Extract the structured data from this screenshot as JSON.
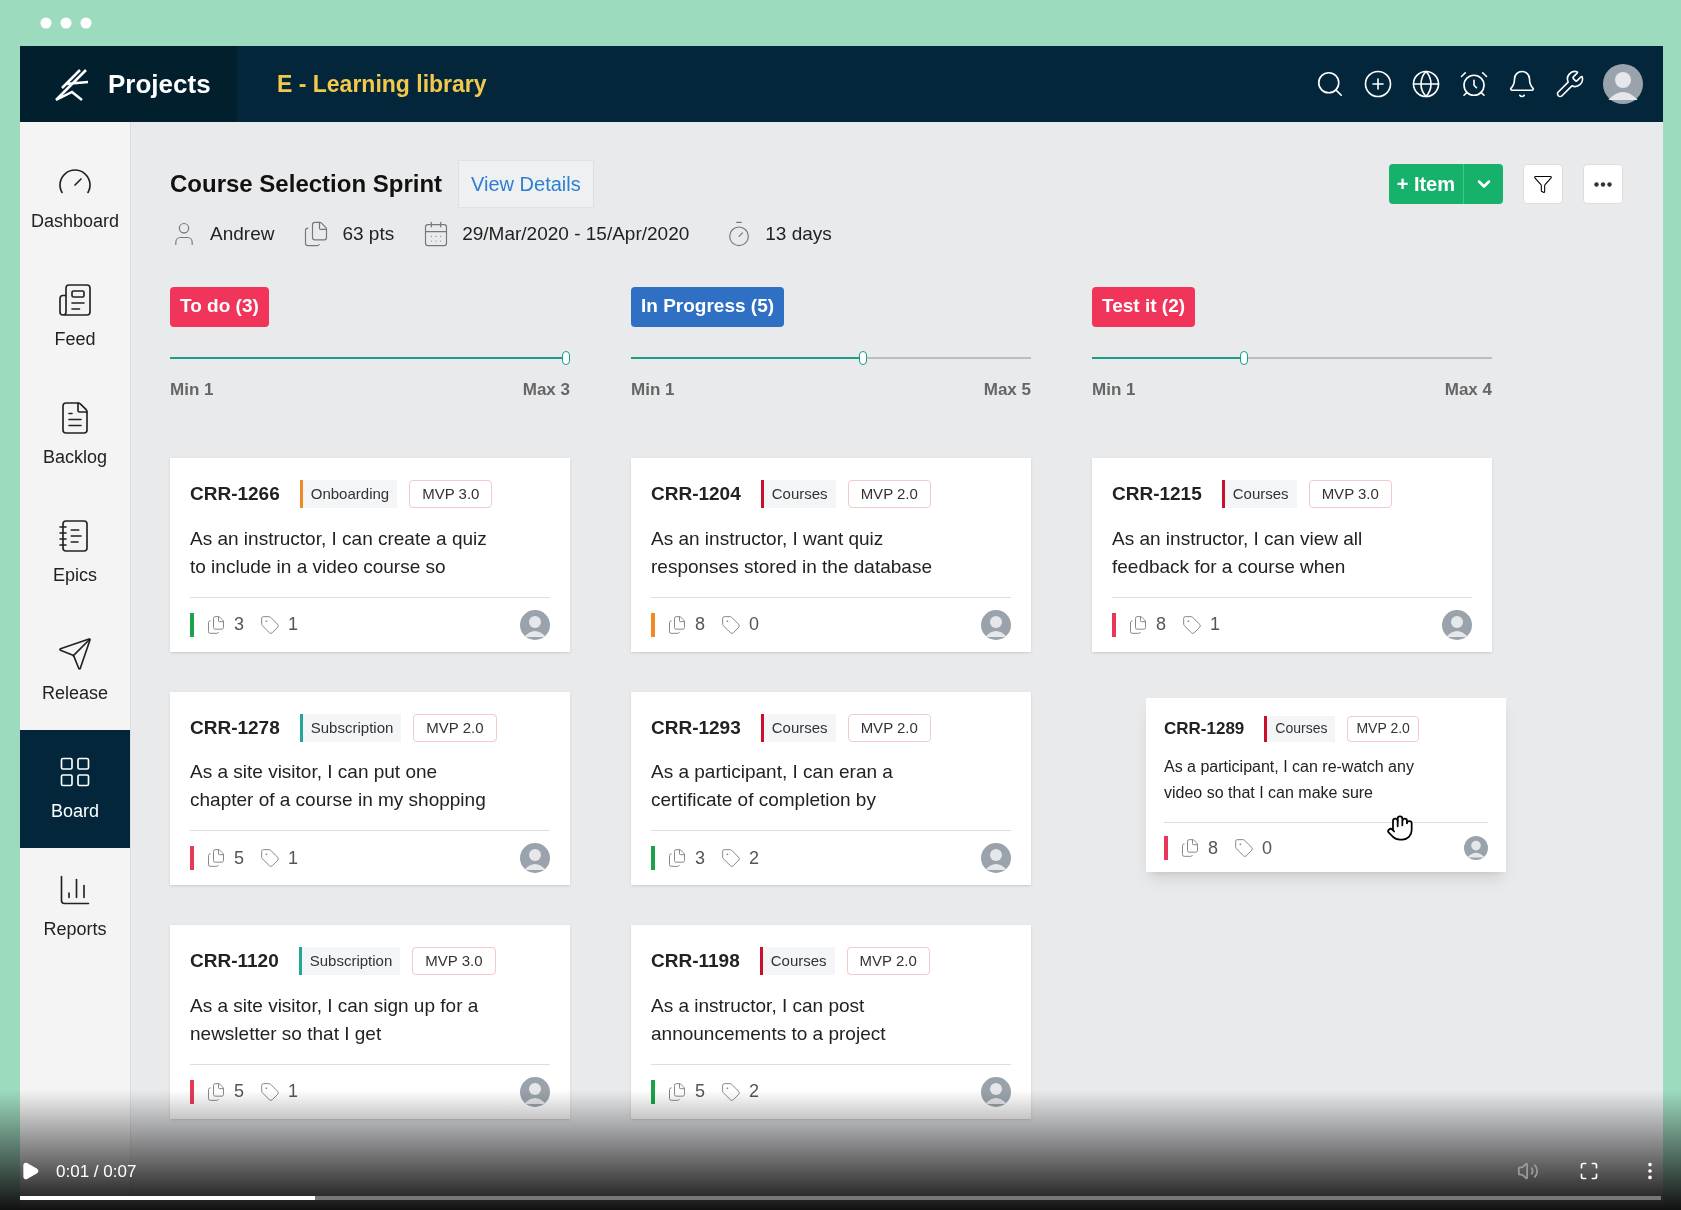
{
  "header": {
    "app": "Projects",
    "project": "E - Learning library"
  },
  "sidebar": {
    "items": [
      {
        "label": "Dashboard",
        "selected": false
      },
      {
        "label": "Feed",
        "selected": false
      },
      {
        "label": "Backlog",
        "selected": false
      },
      {
        "label": "Epics",
        "selected": false
      },
      {
        "label": "Release",
        "selected": false
      },
      {
        "label": "Board",
        "selected": true
      },
      {
        "label": "Reports",
        "selected": false
      }
    ]
  },
  "sprint": {
    "title": "Course Selection Sprint",
    "view_details": "View Details",
    "owner": "Andrew",
    "points": "63 pts",
    "dates": "29/Mar/2020 - 15/Apr/2020",
    "duration": "13 days"
  },
  "toolbar": {
    "add_item": "+ Item"
  },
  "columns": [
    {
      "title": "To do (3)",
      "color": "#f0345a",
      "min": "Min 1",
      "max": "Max 3",
      "level": 1,
      "cards": [
        {
          "id": "CRR-1266",
          "tag": {
            "label": "Onboarding",
            "color": "#f08a24"
          },
          "release": "MVP 3.0",
          "description": "As an instructor, I can create a quiz to include in a video course so",
          "priority": {
            "color": "#1aa34a"
          },
          "points": "3",
          "attachments": "1",
          "dragging": false
        },
        {
          "id": "CRR-1278",
          "tag": {
            "label": "Subscription",
            "color": "#1fa89a"
          },
          "release": "MVP 2.0",
          "description": "As a site visitor, I can put one chapter of a course in my shopping",
          "priority": {
            "color": "#e8385a"
          },
          "points": "5",
          "attachments": "1",
          "dragging": false
        },
        {
          "id": "CRR-1120",
          "tag": {
            "label": "Subscription",
            "color": "#1fa89a"
          },
          "release": "MVP 3.0",
          "description": "As a site visitor, I can sign up for a newsletter so that I get",
          "priority": {
            "color": "#e8385a"
          },
          "points": "5",
          "attachments": "1",
          "dragging": false
        }
      ]
    },
    {
      "title": "In Progress (5)",
      "color": "#2f6fc4",
      "min": "Min 1",
      "max": "Max 5",
      "level": 0.59,
      "cards": [
        {
          "id": "CRR-1204",
          "tag": {
            "label": "Courses",
            "color": "#c8102e"
          },
          "release": "MVP 2.0",
          "description": "As an instructor, I want quiz responses stored in the database",
          "priority": {
            "color": "#f08a24"
          },
          "points": "8",
          "attachments": "0",
          "dragging": false
        },
        {
          "id": "CRR-1293",
          "tag": {
            "label": "Courses",
            "color": "#c8102e"
          },
          "release": "MVP 2.0",
          "description": "As a participant, I can eran a certificate of completion by",
          "priority": {
            "color": "#1aa34a"
          },
          "points": "3",
          "attachments": "2",
          "dragging": false
        },
        {
          "id": "CRR-1198",
          "tag": {
            "label": "Courses",
            "color": "#c8102e"
          },
          "release": "MVP 2.0",
          "description": "As a instructor, I can post announcements to a project",
          "priority": {
            "color": "#1aa34a"
          },
          "points": "5",
          "attachments": "2",
          "dragging": false
        }
      ]
    },
    {
      "title": "Test it (2)",
      "color": "#f0345a",
      "min": "Min 1",
      "max": "Max 4",
      "level": 0.39,
      "cards": [
        {
          "id": "CRR-1215",
          "tag": {
            "label": "Courses",
            "color": "#c8102e"
          },
          "release": "MVP 3.0",
          "description": "As an instructor, I can view all feedback for a course when",
          "priority": {
            "color": "#e8385a"
          },
          "points": "8",
          "attachments": "1",
          "dragging": false
        },
        {
          "id": "CRR-1289",
          "tag": {
            "label": "Courses",
            "color": "#c8102e"
          },
          "release": "MVP 2.0",
          "description": "As a participant, I can re-watch any video so that I can make sure",
          "priority": {
            "color": "#e8385a"
          },
          "points": "8",
          "attachments": "0",
          "dragging": true
        }
      ]
    }
  ],
  "player": {
    "time": "0:01 / 0:07",
    "level": 0.18
  }
}
